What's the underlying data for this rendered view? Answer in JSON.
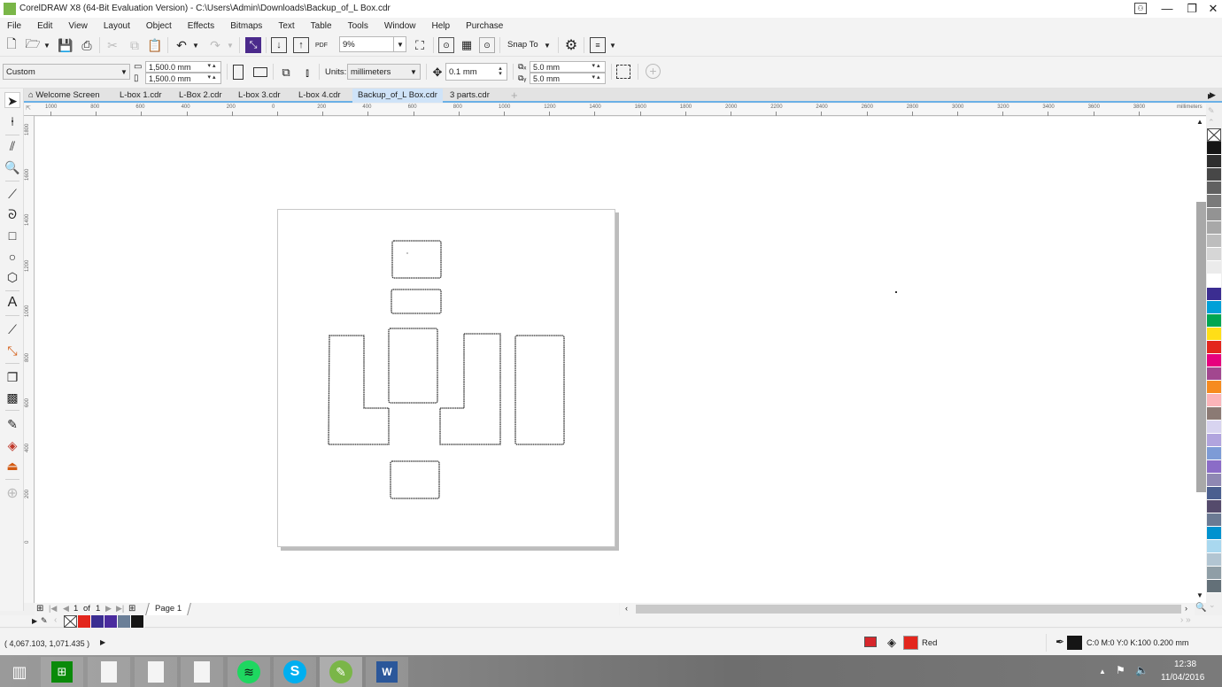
{
  "window": {
    "title": "CorelDRAW X8 (64-Bit Evaluation Version) - C:\\Users\\Admin\\Downloads\\Backup_of_L Box.cdr",
    "minimize": "—",
    "restore": "❐",
    "close": "✕"
  },
  "menu": [
    "File",
    "Edit",
    "View",
    "Layout",
    "Object",
    "Effects",
    "Bitmaps",
    "Text",
    "Table",
    "Tools",
    "Window",
    "Help",
    "Purchase"
  ],
  "toolbar": {
    "zoom_value": "9%",
    "snap_to_label": "Snap To"
  },
  "property_bar": {
    "page_preset": "Custom",
    "width": "1,500.0 mm",
    "height": "1,500.0 mm",
    "units_label": "Units:",
    "units_value": "millimeters",
    "nudge": "0.1 mm",
    "dup_x": "5.0 mm",
    "dup_y": "5.0 mm"
  },
  "tabs": [
    {
      "label": "Welcome Screen",
      "active": false
    },
    {
      "label": "L-box 1.cdr",
      "active": false
    },
    {
      "label": "L-Box 2.cdr",
      "active": false
    },
    {
      "label": "L-box 3.cdr",
      "active": false
    },
    {
      "label": "L-box 4.cdr",
      "active": false
    },
    {
      "label": "Backup_of_L Box.cdr",
      "active": true
    },
    {
      "label": "3 parts.cdr",
      "active": false
    }
  ],
  "rulers": {
    "horizontal_labels": [
      "1000",
      "800",
      "600",
      "400",
      "200",
      "0",
      "200",
      "400",
      "600",
      "800",
      "1000",
      "1200",
      "1400",
      "1600",
      "1800",
      "2000",
      "2200",
      "2400",
      "2600",
      "2800",
      "3000",
      "3200",
      "3400",
      "3600",
      "3800"
    ],
    "unit": "millimeters",
    "vertical_labels": [
      "1800",
      "1600",
      "1400",
      "1200",
      "1000",
      "800",
      "600",
      "400",
      "200",
      "0"
    ]
  },
  "palette_colors": [
    "#151515",
    "#2e2e2e",
    "#474747",
    "#616161",
    "#7a7a7a",
    "#939393",
    "#a8a8a8",
    "#bdbdbd",
    "#d6d6d6",
    "#ebebeb",
    "#ffffff",
    "#3b2d91",
    "#00a0d8",
    "#00a651",
    "#ffde17",
    "#e3261d",
    "#e6007e",
    "#a2478f",
    "#f68b1f",
    "#fbb4b9",
    "#8b7a74",
    "#d8d4f0",
    "#b1a4de",
    "#7d9bd6",
    "#8b6cc7",
    "#8f88b3",
    "#4b5f8f",
    "#554b6c",
    "#6b7a93",
    "#0092cf",
    "#a9d8ef",
    "#b2c5d2",
    "#8f9ea6",
    "#637078"
  ],
  "page_nav": {
    "current": "1",
    "of_label": "of",
    "total": "1",
    "page_tab": "Page 1"
  },
  "document_palette": [
    "#e3261d",
    "#3b2d91",
    "#4a2b9e",
    "#6b7f98",
    "#151515"
  ],
  "status": {
    "coordinates": "( 4,067.103, 1,071.435 )",
    "fill_color_name": "Red",
    "fill_color": "#e3261d",
    "outline_color": "#151515",
    "outline_info": "C:0 M:0 Y:0 K:100  0.200 mm"
  },
  "taskbar": {
    "time": "12:38",
    "date": "11/04/2016"
  }
}
